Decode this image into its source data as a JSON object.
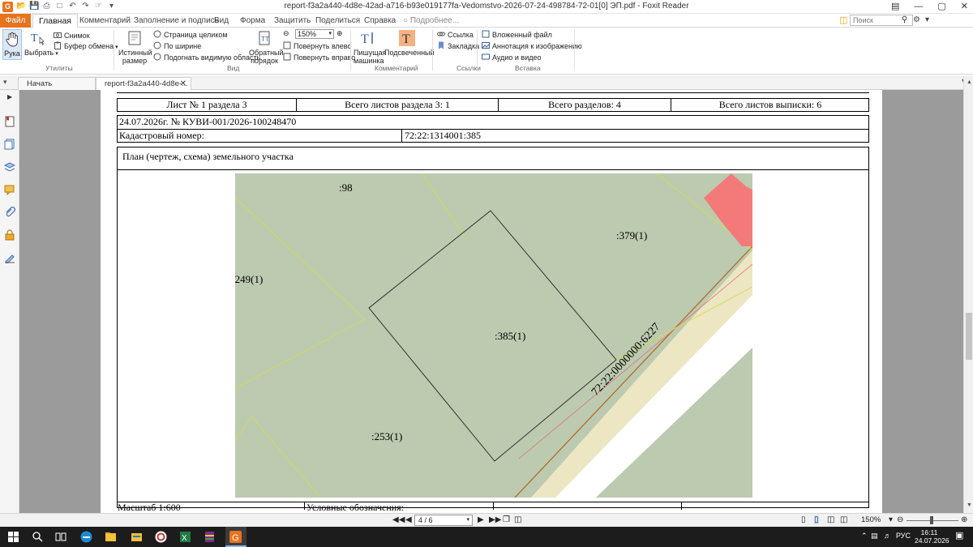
{
  "window": {
    "title": "report-f3a2a440-4d8e-42ad-a716-b93e019177fa-Vedomstvo-2026-07-24-498784-72-01[0] ЭП.pdf - Foxit Reader",
    "search_placeholder": "Поиск",
    "tell_me": "Подробнее..."
  },
  "tabs": [
    {
      "label": "Файл"
    },
    {
      "label": "Главная"
    },
    {
      "label": "Комментарий"
    },
    {
      "label": "Заполнение и подпись"
    },
    {
      "label": "Вид"
    },
    {
      "label": "Форма"
    },
    {
      "label": "Защитить"
    },
    {
      "label": "Поделиться"
    },
    {
      "label": "Справка"
    }
  ],
  "ribbon": {
    "hand": "Рука",
    "select": "Выбрать",
    "snapshot": "Снимок",
    "clipboard": "Буфер обмена",
    "utilities_group": "Утилиты",
    "actual_size_1": "Истинный",
    "actual_size_2": "размер",
    "fit_page": "Страница целиком",
    "fit_width": "По ширине",
    "fit_visible": "Подогнать видимую область",
    "reverse_1": "Обратный",
    "reverse_2": "порядок",
    "zoom_value": "150%",
    "rotate_left": "Повернуть влево",
    "rotate_right": "Повернуть вправо",
    "view_group": "Вид",
    "typewriter_1": "Пишущая",
    "typewriter_2": "машинка",
    "highlight": "Подсвеченный",
    "comments_group": "Комментарий",
    "link": "Ссылка",
    "bookmark": "Закладка",
    "links_group": "Ссылки",
    "embedded_file": "Вложенный файл",
    "image_annotation": "Аннотация к изображению",
    "audio_video": "Аудио и видео",
    "insert_group": "Вставка"
  },
  "doc_tabs": {
    "home": "Начать",
    "doc": "report-f3a2a440-4d8e-..."
  },
  "document": {
    "header_row": {
      "sheet": "Лист № 1 раздела 3",
      "sheets_in_section": "Всего листов раздела 3: 1",
      "sections": "Всего разделов: 4",
      "sheets_total": "Всего листов выписки: 6"
    },
    "date_number": "24.07.2026г. № КУВИ-001/2026-100248470",
    "cadastral_label": "Кадастровый номер:",
    "cadastral_value": "72:22:1314001:385",
    "plan_title": "План (чертеж, схема) земельного участка",
    "map_labels": {
      "p98": ":98",
      "p379": ":379(1)",
      "p249": ":249(1)",
      "p385": ":385(1)",
      "p253": ":253(1)",
      "road": "72:22:0000000:6227"
    },
    "scale": "Масштаб 1:600",
    "legend": "Условные обозначения:"
  },
  "statusbar": {
    "page": "4 / 6",
    "zoom": "150%"
  },
  "tray": {
    "lang": "РУС",
    "time": "16:11",
    "date": "24.07.2026"
  },
  "colors": {
    "foxit_orange": "#e8731e",
    "parcel_fill": "#bccab0",
    "road_fill": "#ece6c3",
    "building_fill": "#f47a7a"
  }
}
